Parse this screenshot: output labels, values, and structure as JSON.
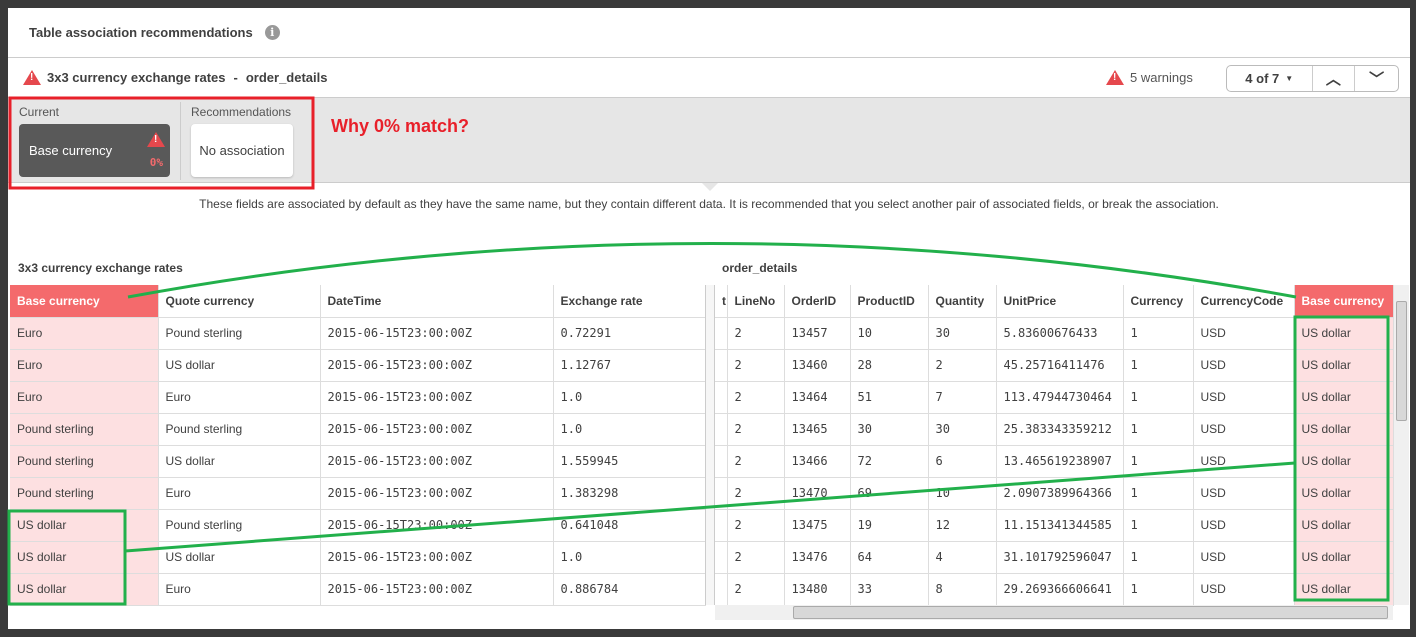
{
  "title": "Table association recommendations",
  "subheader": {
    "left_table": "3x3 currency exchange rates",
    "separator": "-",
    "right_table": "order_details",
    "warnings": "5 warnings",
    "pager": "4 of 7"
  },
  "current": {
    "label": "Current",
    "field": "Base currency",
    "match": "0%"
  },
  "recommendations": {
    "label": "Recommendations",
    "item": "No association"
  },
  "annotation": "Why 0% match?",
  "description": "These fields are associated by default as they have the same name, but they contain different data. It is recommended that you select another pair of associated fields, or break the association.",
  "left_table": {
    "name": "3x3 currency exchange rates",
    "headers": [
      "Base currency",
      "Quote currency",
      "DateTime",
      "Exchange rate"
    ],
    "rows": [
      [
        "Euro",
        "Pound sterling",
        "2015-06-15T23:00:00Z",
        "0.72291"
      ],
      [
        "Euro",
        "US dollar",
        "2015-06-15T23:00:00Z",
        "1.12767"
      ],
      [
        "Euro",
        "Euro",
        "2015-06-15T23:00:00Z",
        "1.0"
      ],
      [
        "Pound sterling",
        "Pound sterling",
        "2015-06-15T23:00:00Z",
        "1.0"
      ],
      [
        "Pound sterling",
        "US dollar",
        "2015-06-15T23:00:00Z",
        "1.559945"
      ],
      [
        "Pound sterling",
        "Euro",
        "2015-06-15T23:00:00Z",
        "1.383298"
      ],
      [
        "US dollar",
        "Pound sterling",
        "2015-06-15T23:00:00Z",
        "0.641048"
      ],
      [
        "US dollar",
        "US dollar",
        "2015-06-15T23:00:00Z",
        "1.0"
      ],
      [
        "US dollar",
        "Euro",
        "2015-06-15T23:00:00Z",
        "0.886784"
      ]
    ]
  },
  "right_table": {
    "name": "order_details",
    "headers": [
      "t",
      "LineNo",
      "OrderID",
      "ProductID",
      "Quantity",
      "UnitPrice",
      "Currency",
      "CurrencyCode",
      "Base currency"
    ],
    "rows": [
      [
        "",
        "2",
        "13457",
        "10",
        "30",
        "5.83600676433",
        "1",
        "USD",
        "US dollar"
      ],
      [
        "",
        "2",
        "13460",
        "28",
        "2",
        "45.25716411476",
        "1",
        "USD",
        "US dollar"
      ],
      [
        "",
        "2",
        "13464",
        "51",
        "7",
        "113.47944730464",
        "1",
        "USD",
        "US dollar"
      ],
      [
        "",
        "2",
        "13465",
        "30",
        "30",
        "25.383343359212",
        "1",
        "USD",
        "US dollar"
      ],
      [
        "",
        "2",
        "13466",
        "72",
        "6",
        "13.465619238907",
        "1",
        "USD",
        "US dollar"
      ],
      [
        "",
        "2",
        "13470",
        "69",
        "10",
        "2.0907389964366",
        "1",
        "USD",
        "US dollar"
      ],
      [
        "",
        "2",
        "13475",
        "19",
        "12",
        "11.151341344585",
        "1",
        "USD",
        "US dollar"
      ],
      [
        "",
        "2",
        "13476",
        "64",
        "4",
        "31.101792596047",
        "1",
        "USD",
        "US dollar"
      ],
      [
        "",
        "2",
        "13480",
        "33",
        "8",
        "29.269366606641",
        "1",
        "USD",
        "US dollar"
      ]
    ]
  },
  "colors": {
    "warning": "#e5484d",
    "highlight_header": "#f46a6c",
    "highlight_cell": "#fde0e1",
    "annotation_red": "#e8202a",
    "annotation_green": "#22b04b"
  }
}
